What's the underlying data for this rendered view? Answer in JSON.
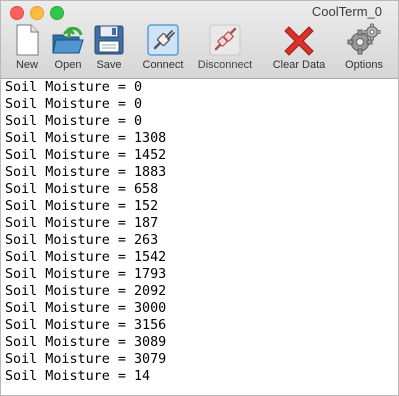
{
  "window": {
    "title": "CoolTerm_0"
  },
  "toolbar": {
    "new_label": "New",
    "open_label": "Open",
    "save_label": "Save",
    "connect_label": "Connect",
    "disconnect_label": "Disconnect",
    "clear_label": "Clear Data",
    "options_label": "Options"
  },
  "terminal": {
    "lines": [
      "Soil Moisture = 0",
      "Soil Moisture = 0",
      "Soil Moisture = 0",
      "Soil Moisture = 1308",
      "Soil Moisture = 1452",
      "Soil Moisture = 1883",
      "Soil Moisture = 658",
      "Soil Moisture = 152",
      "Soil Moisture = 187",
      "Soil Moisture = 263",
      "Soil Moisture = 1542",
      "Soil Moisture = 1793",
      "Soil Moisture = 2092",
      "Soil Moisture = 3000",
      "Soil Moisture = 3156",
      "Soil Moisture = 3089",
      "Soil Moisture = 3079",
      "Soil Moisture = 14"
    ]
  },
  "icons": {
    "new": "document-icon",
    "open": "folder-open-icon",
    "save": "floppy-disk-icon",
    "connect": "plug-connected-icon",
    "disconnect": "plug-disconnected-icon",
    "clear": "red-x-icon",
    "options": "gears-icon"
  },
  "colors": {
    "clear_red": "#d8322b",
    "connect_blue": "#5b9bd5"
  }
}
